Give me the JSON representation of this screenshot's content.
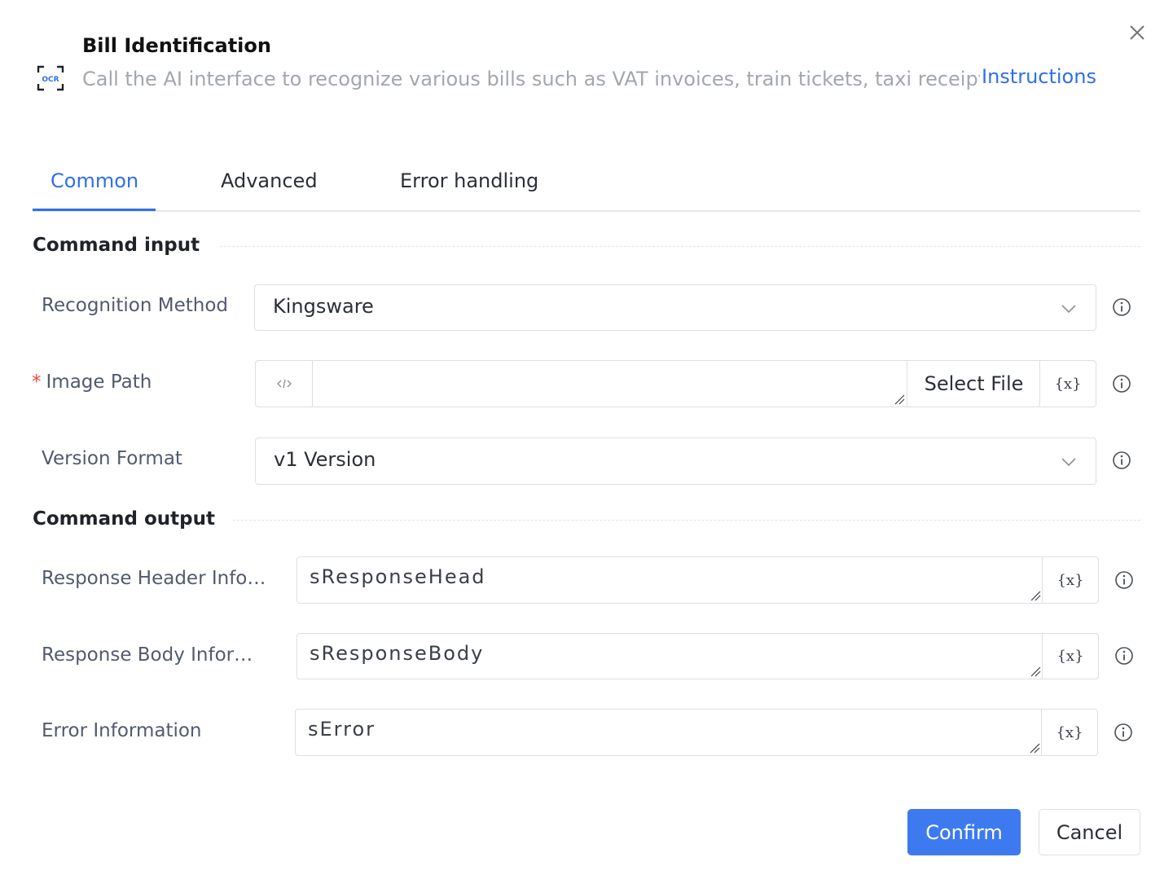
{
  "header": {
    "icon": "ocr-scan-icon",
    "icon_text": "OCR",
    "title": "Bill Identification",
    "description": "Call the AI interface to recognize various bills such as VAT invoices, train tickets, taxi receipts, etc.",
    "link": "Instructions"
  },
  "tabs": [
    {
      "label": "Common",
      "active": true
    },
    {
      "label": "Advanced",
      "active": false
    },
    {
      "label": "Error handling",
      "active": false
    }
  ],
  "input_section": {
    "title": "Command input",
    "recognition_method": {
      "label": "Recognition Method",
      "value": "Kingsware"
    },
    "image_path": {
      "required_mark": "*",
      "label": "Image Path",
      "value": "",
      "select_file": "Select File",
      "var_button": "{x}"
    },
    "version_format": {
      "label": "Version Format",
      "value": "v1 Version"
    }
  },
  "output_section": {
    "title": "Command output",
    "response_header": {
      "label": "Response Header Info…",
      "value": "sResponseHead",
      "var_button": "{x}"
    },
    "response_body": {
      "label": "Response Body Infor…",
      "value": "sResponseBody",
      "var_button": "{x}"
    },
    "error_info": {
      "label": "Error Information",
      "value": "sError",
      "var_button": "{x}"
    }
  },
  "footer": {
    "confirm": "Confirm",
    "cancel": "Cancel"
  },
  "colors": {
    "accent": "#2f6fea",
    "primary_button": "#3d7af0",
    "required": "#f04a3a"
  }
}
